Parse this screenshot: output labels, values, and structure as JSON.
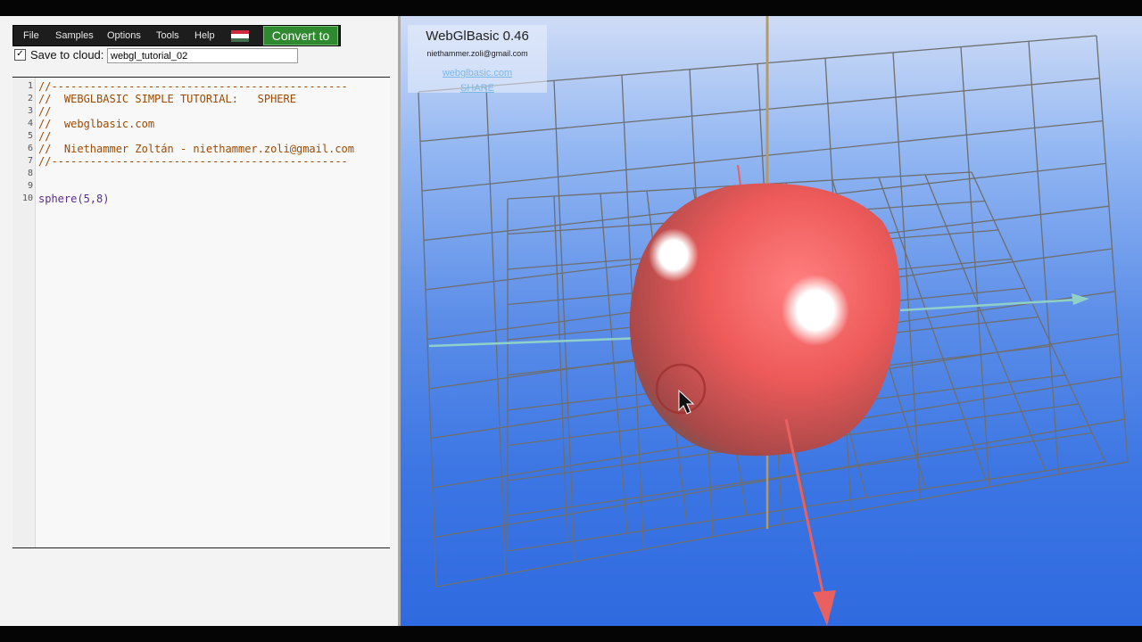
{
  "menubar": {
    "items": [
      "File",
      "Samples",
      "Options",
      "Tools",
      "Help"
    ],
    "flag_colors": [
      "#cd2a3e",
      "#ffffff",
      "#436f4d"
    ],
    "convert_label": "Convert to"
  },
  "cloud": {
    "checked": true,
    "label": "Save to cloud:",
    "filename": "webgl_tutorial_02"
  },
  "editor": {
    "lines": [
      {
        "num": "1",
        "text": "//----------------------------------------------",
        "kind": "comment"
      },
      {
        "num": "2",
        "text": "//  WEBGLBASIC SIMPLE TUTORIAL:   SPHERE",
        "kind": "comment"
      },
      {
        "num": "3",
        "text": "//",
        "kind": "comment"
      },
      {
        "num": "4",
        "text": "//  webglbasic.com",
        "kind": "comment"
      },
      {
        "num": "5",
        "text": "//",
        "kind": "comment"
      },
      {
        "num": "6",
        "text": "//  Niethammer Zoltán - niethammer.zoli@gmail.com",
        "kind": "comment"
      },
      {
        "num": "7",
        "text": "//----------------------------------------------",
        "kind": "comment"
      },
      {
        "num": "8",
        "text": "",
        "kind": "comment"
      },
      {
        "num": "9",
        "text": "",
        "kind": "comment"
      },
      {
        "num": "10",
        "text": "sphere(5,8)",
        "kind": "code"
      }
    ]
  },
  "viewport": {
    "title": "WebGlBasic 0.46",
    "email": "niethammer.zoli@gmail.com",
    "link_site": "webglbasic.com",
    "link_share": "SHARE",
    "sphere_color": "#ee5a5a",
    "grid_color": "#6e6e6e",
    "axis_y_color": "#b49a6a",
    "axis_x_color": "#8fd1c8",
    "axis_z_color": "#e86060"
  }
}
